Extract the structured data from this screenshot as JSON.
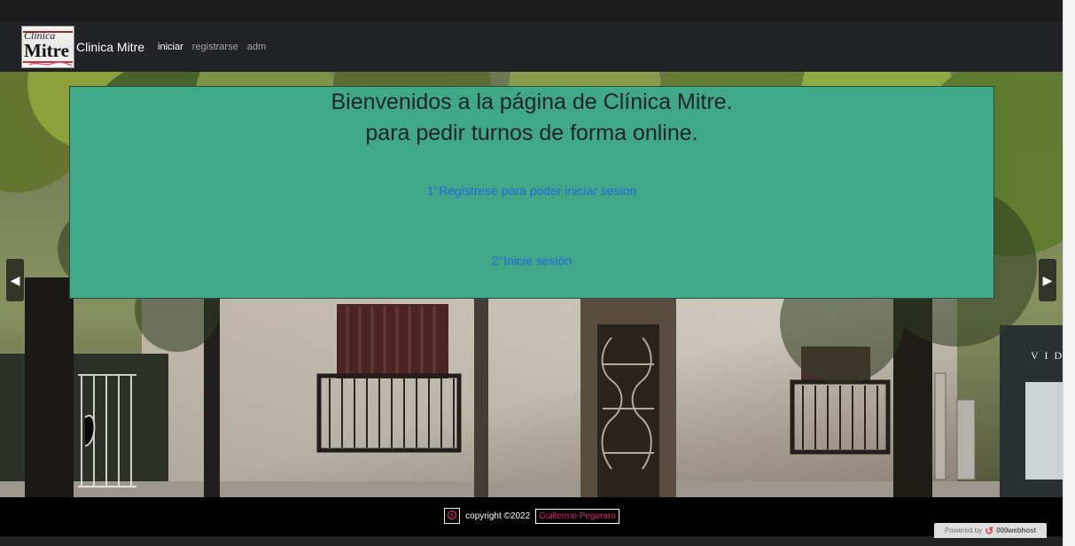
{
  "header": {
    "logo_lines": [
      "Clínica",
      "Mitre"
    ],
    "brand_name": "Clinica Mitre",
    "nav": [
      "iniciar",
      "registrarse",
      "adm"
    ]
  },
  "hero": {
    "title_line_1": "Bienvenidos a la página de Clínica Mitre.",
    "title_line_2": "para pedir turnos de forma online.",
    "step_1": "1°Registrese para poder iniciar sesion",
    "step_2": "2°Inicie sesión",
    "prev_icon": "◀",
    "next_icon": "▶",
    "sign_text": "V I D"
  },
  "footer": {
    "whatsapp_icon": "whatsapp-icon",
    "copyright": "copyright ©2022",
    "author": "Guillermo Pegoraro"
  },
  "powered_badge": {
    "prefix": "Powered by",
    "brand": "000webhost"
  },
  "colors": {
    "card": "#40a787",
    "link": "#1e6ce0",
    "author": "#e3237d"
  }
}
